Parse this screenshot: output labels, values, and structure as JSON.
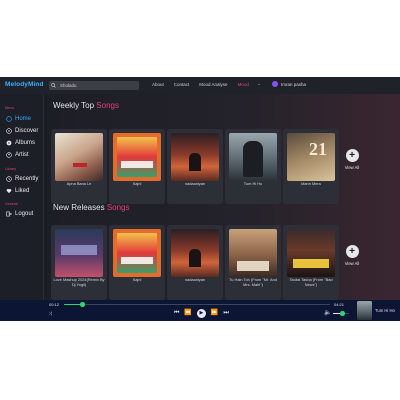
{
  "app": {
    "logo": "MelodyMind"
  },
  "search": {
    "value": "Sholadu"
  },
  "nav": {
    "items": [
      "About",
      "Contact",
      "Mood Analyse",
      "Mood"
    ]
  },
  "user": {
    "name": "Imran pasha"
  },
  "sidebar": {
    "menu_title": "Menu",
    "menu": [
      "Home",
      "Discover",
      "Albums",
      "Artist"
    ],
    "library_title": "Library",
    "library": [
      "Recently",
      "Liked"
    ],
    "general_title": "General",
    "general": [
      "Logout"
    ]
  },
  "weekly": {
    "heading": "Weekly Top",
    "accent": "Songs",
    "cards": [
      {
        "title": "Apna Bana Le"
      },
      {
        "title": "Sajni"
      },
      {
        "title": "nadaaniyan"
      },
      {
        "title": "Tum Hi Ho"
      },
      {
        "title": "Mann Mera"
      }
    ],
    "view_all": "View All"
  },
  "releases": {
    "heading": "New Releases",
    "accent": "Songs",
    "cards": [
      {
        "title": "Love Mashup 2024(Remix By Dj Yogii)"
      },
      {
        "title": "Sajni"
      },
      {
        "title": "nadaaniyan"
      },
      {
        "title": "Tu Hain Toh (From \"Mr. And Mrs. Mahi\")"
      },
      {
        "title": "Tauba Tauba (From \"Bad Newz\")"
      }
    ],
    "view_all": "View All"
  },
  "player": {
    "current": "00:12",
    "duration": "04:21",
    "progress": 0.07,
    "volume": 0.6,
    "now_title": "Tum Hi Ho"
  },
  "colors": {
    "accent": "#e63f80",
    "brand": "#3ab0ff",
    "progress": "#2ed573",
    "player_bg": "#0c1533"
  }
}
